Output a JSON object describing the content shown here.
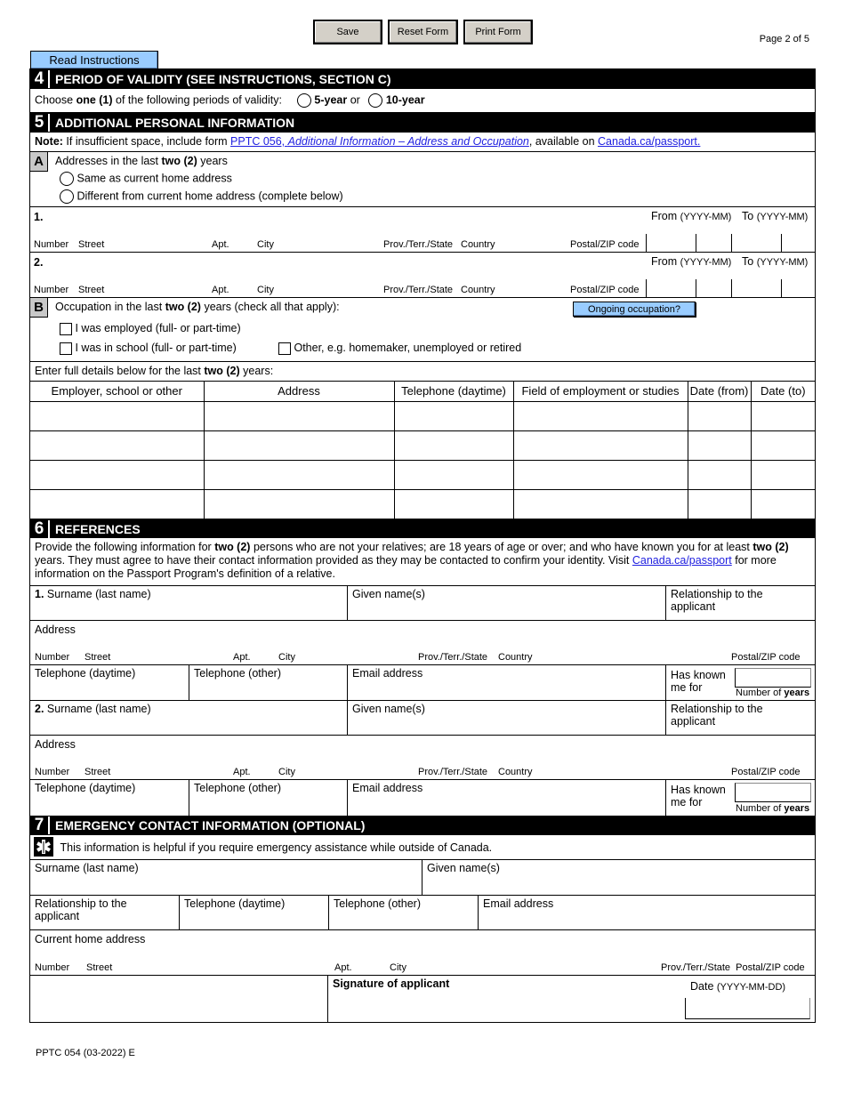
{
  "toolbar": {
    "save": "Save",
    "reset": "Reset Form",
    "print": "Print Form"
  },
  "page_indicator": "Page 2 of 5",
  "read_instructions": "Read Instructions",
  "section4": {
    "num": "4",
    "title": "PERIOD OF VALIDITY (SEE INSTRUCTIONS, SECTION C)",
    "prompt_pre": "Choose ",
    "prompt_bold": "one (1)",
    "prompt_post": " of the following periods of validity:",
    "option_5": "5-year",
    "or": "or",
    "option_10": "10-year"
  },
  "section5": {
    "num": "5",
    "title": "ADDITIONAL PERSONAL INFORMATION",
    "note_label": "Note:",
    "note_text": " If insufficient space, include form ",
    "note_link1_code": "PPTC 056, ",
    "note_link1_title": "Additional Information – Address and Occupation",
    "note_mid": ", available on ",
    "note_link2": "Canada.ca/passport.",
    "partA": {
      "letter": "A",
      "prompt_pre": "Addresses in the last ",
      "prompt_bold": "two (2)",
      "prompt_post": " years",
      "opt_same": "Same as current home address",
      "opt_diff": "Different from current home address (complete below)"
    },
    "address_rows": [
      {
        "num": "1.",
        "from": "From",
        "from_fmt": "(YYYY-MM)",
        "to": "To",
        "to_fmt": "(YYYY-MM)"
      },
      {
        "num": "2.",
        "from": "From",
        "from_fmt": "(YYYY-MM)",
        "to": "To",
        "to_fmt": "(YYYY-MM)"
      }
    ],
    "addr_sublabels": {
      "number": "Number",
      "street": "Street",
      "apt": "Apt.",
      "city": "City",
      "prov": "Prov./Terr./State",
      "country": "Country",
      "postal": "Postal/ZIP code"
    },
    "partB": {
      "letter": "B",
      "prompt_pre": "Occupation in the last ",
      "prompt_bold": "two (2)",
      "prompt_post": " years (check all that apply):",
      "ongoing_button": "Ongoing occupation?",
      "opt_employed": "I was employed (full- or part-time)",
      "opt_school": "I was in school (full- or part-time)",
      "opt_other": "Other, e.g. homemaker, unemployed or retired"
    },
    "details_pre": "Enter full details below for the last ",
    "details_bold": "two (2)",
    "details_post": " years:",
    "occ_columns": [
      "Employer, school or other",
      "Address",
      "Telephone (daytime)",
      "Field of employment or studies",
      "Date (from)",
      "Date (to)"
    ],
    "occ_rows": 4
  },
  "section6": {
    "num": "6",
    "title": "REFERENCES",
    "intro_1": "Provide the following information for ",
    "intro_b1": "two (2)",
    "intro_2": " persons who are not your relatives; are 18 years of age or over; and who have known you for at least ",
    "intro_b2": "two (2)",
    "intro_3": " years. They must agree to have their contact information provided as they may be contacted to confirm your identity. Visit ",
    "intro_link": "Canada.ca/passport",
    "intro_4": " for more information on the Passport Program's definition of a relative.",
    "references": [
      {
        "num": "1.",
        "surname": " Surname (last name)",
        "given": "Given name(s)",
        "relationship": "Relationship to the applicant",
        "address": "Address",
        "tel_day": "Telephone (daytime)",
        "tel_other": "Telephone (other)",
        "email": "Email address",
        "known_1": "Has known",
        "known_2": "me for",
        "years_pre": "Number of ",
        "years_bold": "years"
      },
      {
        "num": "2.",
        "surname": " Surname (last name)",
        "given": "Given name(s)",
        "relationship": "Relationship to the applicant",
        "address": "Address",
        "tel_day": "Telephone (daytime)",
        "tel_other": "Telephone (other)",
        "email": "Email address",
        "known_1": "Has known",
        "known_2": "me for",
        "years_pre": "Number of ",
        "years_bold": "years"
      }
    ],
    "ref_sublabels": {
      "number": "Number",
      "street": "Street",
      "apt": "Apt.",
      "city": "City",
      "prov": "Prov./Terr./State",
      "country": "Country",
      "postal": "Postal/ZIP code"
    }
  },
  "section7": {
    "num": "7",
    "title": "EMERGENCY CONTACT INFORMATION (OPTIONAL)",
    "info": "This information is helpful if you require emergency assistance while outside of Canada.",
    "surname": "Surname (last name)",
    "given": "Given name(s)",
    "relationship": "Relationship to the applicant",
    "tel_day": "Telephone (daytime)",
    "tel_other": "Telephone (other)",
    "email": "Email address",
    "home_address": "Current home address",
    "sublabels": {
      "number": "Number",
      "street": "Street",
      "apt": "Apt.",
      "city": "City",
      "prov_postal": "Prov./Terr./State  Postal/ZIP code"
    },
    "signature": "Signature of applicant",
    "date": "Date",
    "date_fmt": "(YYYY-MM-DD)"
  },
  "footer": "PPTC 054 (03-2022) E"
}
